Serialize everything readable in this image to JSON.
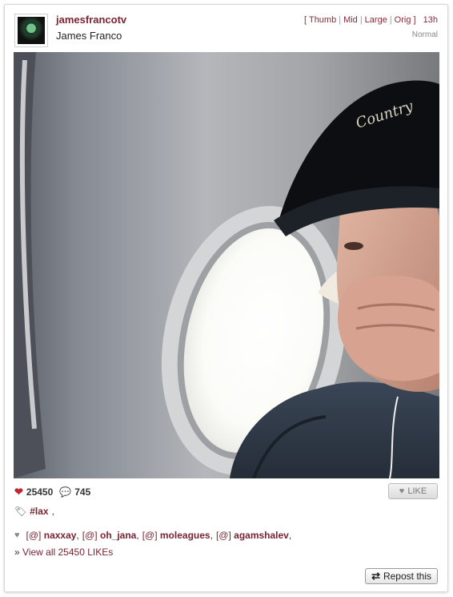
{
  "header": {
    "username": "jamesfrancotv",
    "full_name": "James Franco",
    "size_open_bracket": "[",
    "size_close_bracket": "]",
    "sizes": [
      "Thumb",
      "Mid",
      "Large",
      "Orig"
    ],
    "age": "13h",
    "filter": "Normal"
  },
  "photo": {
    "icon": "airplane-window-portrait-photo"
  },
  "stats": {
    "likes": "25450",
    "comments": "745",
    "like_icon": "heart-icon",
    "comment_icon": "speech-bubble-icon",
    "like_color": "#c0262f",
    "comment_color": "#2b8ab8"
  },
  "like_button": {
    "label": "LIKE"
  },
  "tags": {
    "items": [
      "#lax"
    ]
  },
  "likers": {
    "at_label": "[@]",
    "names": [
      "naxxay",
      "oh_jana",
      "moleagues",
      "agamshalev"
    ]
  },
  "view_all": {
    "prefix": "»",
    "label": "View all 25450 LIKEs"
  },
  "repost_button": {
    "label": "Repost this"
  },
  "colors": {
    "link": "#7a2433",
    "accent": "#8a2a3a"
  }
}
